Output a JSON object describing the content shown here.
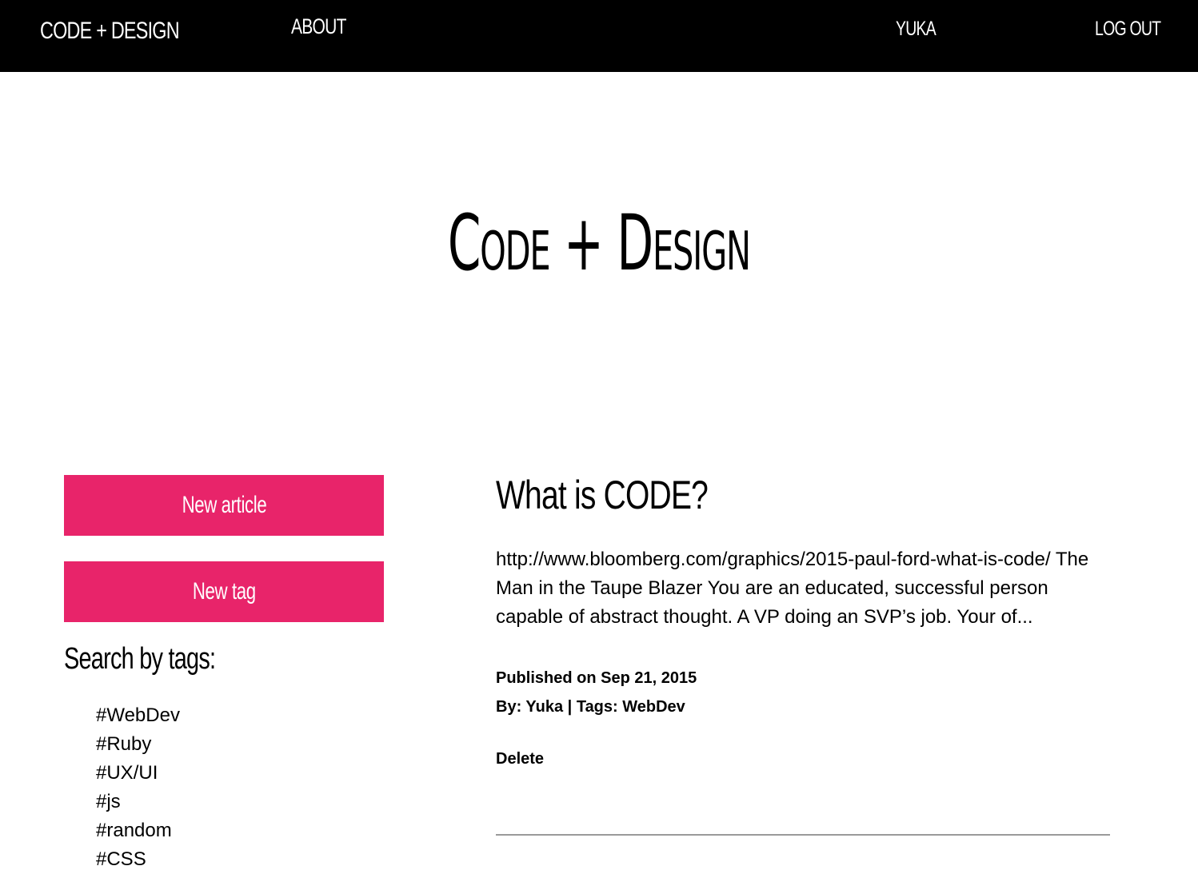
{
  "nav": {
    "brand": "CODE + DESIGN",
    "about": "ABOUT",
    "user": "YUKA",
    "logout": "LOG OUT"
  },
  "hero": {
    "title": "Code + Design"
  },
  "sidebar": {
    "new_article_label": "New article",
    "new_tag_label": "New tag",
    "search_heading": "Search by tags:",
    "tags": [
      "#WebDev",
      "#Ruby",
      "#UX/UI",
      "#js",
      "#random",
      "#CSS"
    ]
  },
  "article": {
    "title": "What is CODE?",
    "excerpt": "http://www.bloomberg.com/graphics/2015-paul-ford-what-is-code/ The Man in the Taupe Blazer You are an educated, successful person capable of abstract thought. A VP doing an SVP’s job. Your of...",
    "published": "Published on Sep 21, 2015",
    "byline": "By: Yuka | Tags: WebDev",
    "delete_label": "Delete"
  },
  "colors": {
    "accent": "#e8246a",
    "nav_bg": "#000000"
  }
}
